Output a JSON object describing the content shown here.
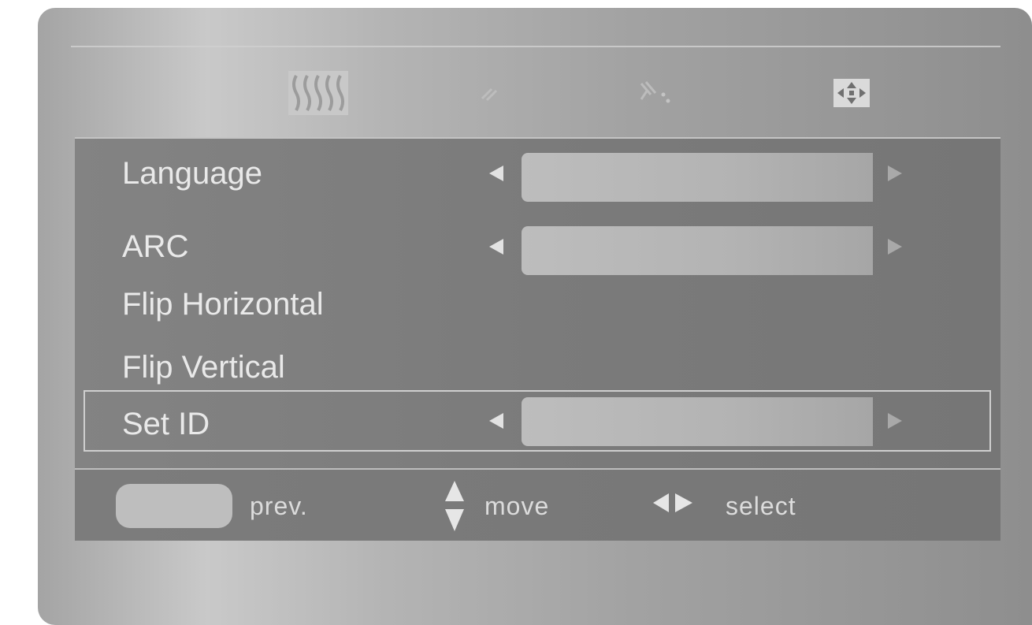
{
  "menu": {
    "tabs": [
      {
        "icon": "picture-waves-icon"
      },
      {
        "icon": "sound-icon"
      },
      {
        "icon": "time-icon"
      },
      {
        "icon": "special-arrows-icon"
      }
    ],
    "items": [
      {
        "label": "Language",
        "has_value": true
      },
      {
        "label": "ARC",
        "has_value": true
      },
      {
        "label": "Flip Horizontal",
        "has_value": false
      },
      {
        "label": "Flip Vertical",
        "has_value": false
      },
      {
        "label": "Set ID",
        "has_value": true,
        "selected": true
      }
    ]
  },
  "footer": {
    "prev_label": "prev.",
    "move_label": "move",
    "select_label": "select"
  }
}
